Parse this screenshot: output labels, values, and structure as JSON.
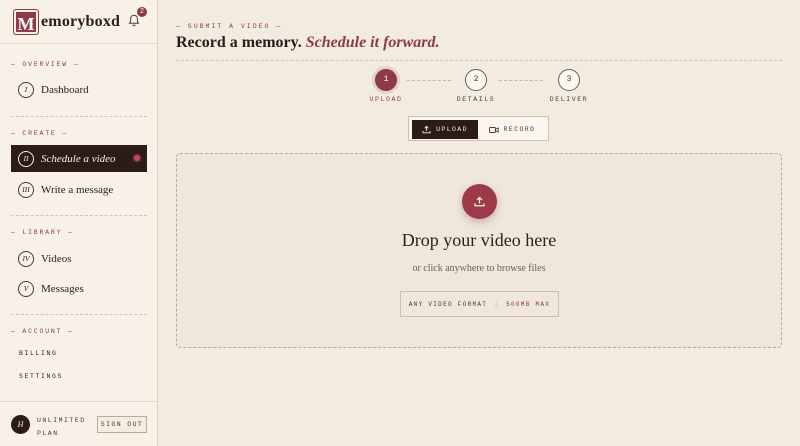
{
  "app": {
    "logo_letter": "M",
    "logo_text": "emoryboxd",
    "notification_count": "2"
  },
  "sidebar": {
    "sections": {
      "overview": "— OVERVIEW —",
      "create": "— CREATE —",
      "library": "— LIBRARY —",
      "account": "— ACCOUNT —"
    },
    "items": [
      {
        "numeral": "I",
        "label": "Dashboard",
        "active": false
      },
      {
        "numeral": "II",
        "label": "Schedule a video",
        "active": true
      },
      {
        "numeral": "III",
        "label": "Write a message",
        "active": false
      },
      {
        "numeral": "IV",
        "label": "Videos",
        "active": false
      },
      {
        "numeral": "V",
        "label": "Messages",
        "active": false
      }
    ],
    "account_links": [
      "BILLING",
      "SETTINGS"
    ],
    "user": {
      "avatar_initial": "H",
      "plan_line1": "UNLIMITED",
      "plan_line2": "PLAN",
      "sign_out_label": "SIGN OUT"
    }
  },
  "main": {
    "eyebrow": "— SUBMIT A VIDEO —",
    "title_plain": "Record a memory.",
    "title_emphasis": "Schedule it forward.",
    "steps": [
      {
        "number": "1",
        "label": "UPLOAD",
        "active": true
      },
      {
        "number": "2",
        "label": "DETAILS",
        "active": false
      },
      {
        "number": "3",
        "label": "DELIVER",
        "active": false
      }
    ],
    "mode_toggle": {
      "upload_label": "UPLOAD",
      "record_label": "RECORD",
      "selected": "UPLOAD"
    },
    "dropzone": {
      "title": "Drop your video here",
      "subtitle": "or click anywhere to browse files",
      "format_hint": "ANY VIDEO FORMAT",
      "size_hint": "500MB MAX"
    }
  },
  "colors": {
    "accent": "#8e3b46",
    "dark": "#2b1c18",
    "background": "#f2ebe0"
  }
}
